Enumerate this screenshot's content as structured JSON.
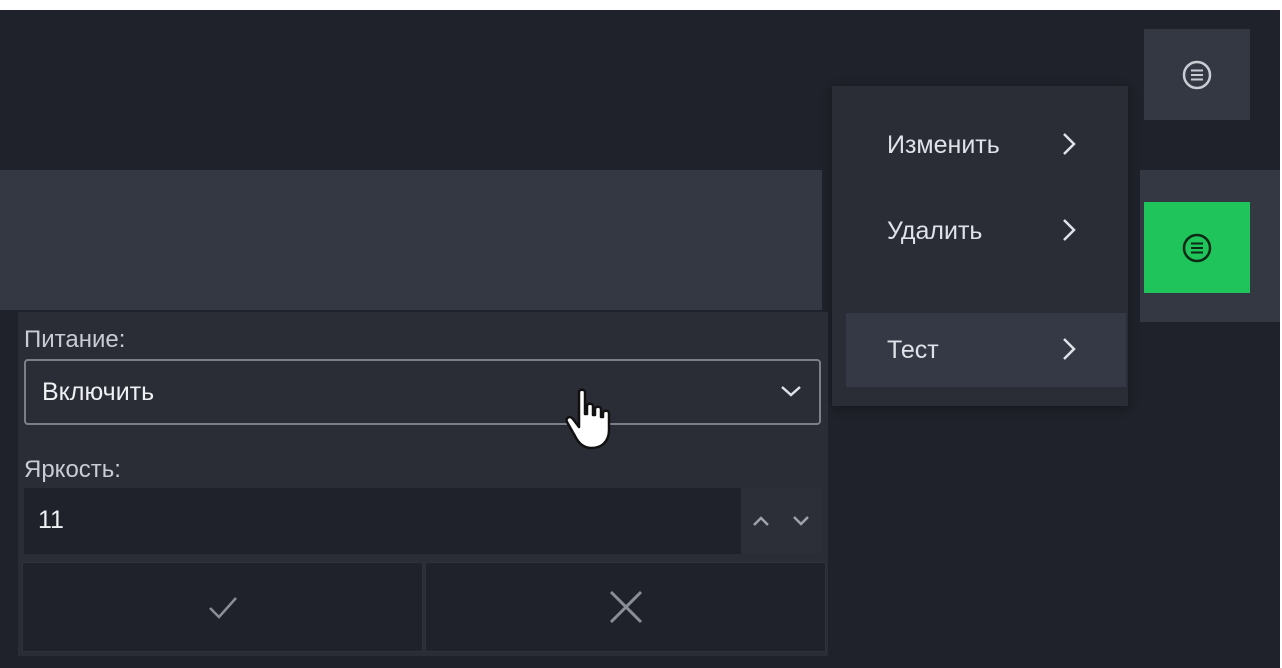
{
  "context_menu": {
    "items": [
      {
        "label": "Изменить",
        "icon": "chevron-right-icon"
      },
      {
        "label": "Удалить",
        "icon": "chevron-right-icon"
      },
      {
        "label": "Тест",
        "icon": "chevron-right-icon"
      }
    ]
  },
  "form": {
    "power_label": "Питание:",
    "power_value": "Включить",
    "brightness_label": "Яркость:",
    "brightness_value": "11",
    "confirm_icon": "check-icon",
    "cancel_icon": "close-icon"
  },
  "buttons": {
    "top_menu_icon": "list-circle-icon",
    "green_menu_icon": "list-circle-icon"
  },
  "colors": {
    "background": "#1f222a",
    "panel": "#343843",
    "accent_green": "#1fc45a",
    "text": "#dfe2e8"
  }
}
